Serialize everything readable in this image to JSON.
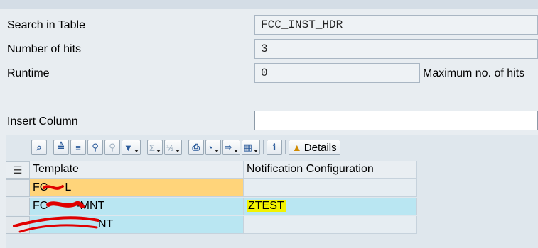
{
  "form": {
    "search_label": "Search in Table",
    "search_value": "FCC_INST_HDR",
    "hits_label": "Number of hits",
    "hits_value": "3",
    "runtime_label": "Runtime",
    "runtime_value": "0",
    "max_hits_label": "Maximum no. of hits",
    "insert_column_label": "Insert Column",
    "insert_column_value": ""
  },
  "toolbar": {
    "buttons": [
      "details-view-icon",
      "sort-ascending-icon",
      "sort-descending-icon",
      "find-icon",
      "find-next-icon",
      "filter-icon",
      "total-icon",
      "subtotal-icon",
      "print-icon",
      "views-icon",
      "export-icon",
      "layout-icon",
      "info-icon"
    ],
    "details_label": "Details",
    "details_icon": "mountain-icon"
  },
  "table": {
    "columns": [
      "Template",
      "Notification Configuration"
    ],
    "rows": [
      {
        "template": "FC",
        "template_tail": "L",
        "notification": ""
      },
      {
        "template": "FC",
        "template_tail": "-MNT",
        "notification": "ZTEST"
      },
      {
        "template": "",
        "template_tail": "NT",
        "notification": ""
      }
    ]
  },
  "colors": {
    "row_selected": "#ffd47a",
    "row_highlight": "#b9e6f2",
    "text_highlight": "#f2f200",
    "redaction": "#e00000"
  }
}
